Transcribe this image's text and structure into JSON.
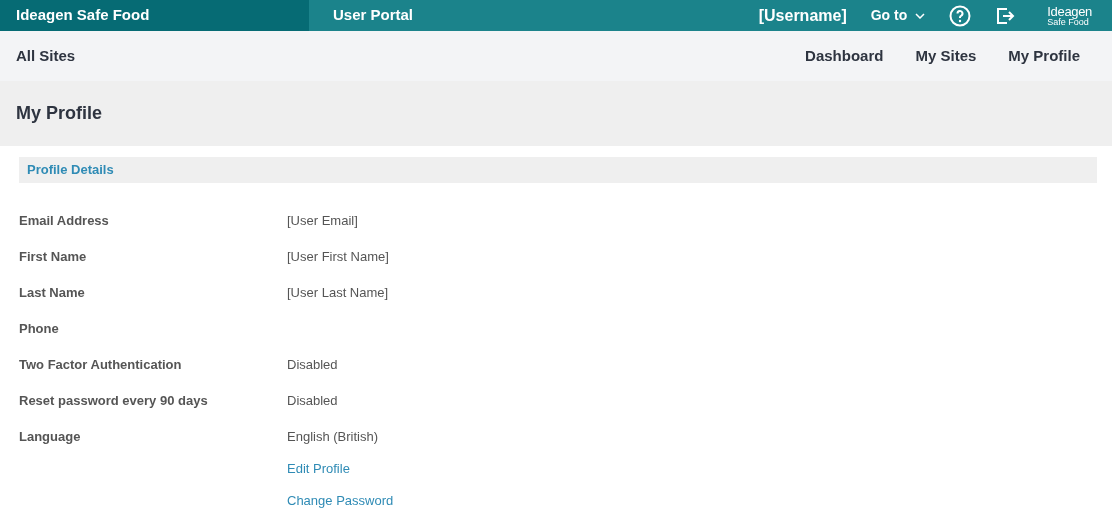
{
  "top_bar": {
    "brand": "Ideagen Safe Food",
    "portal": "User Portal",
    "username": "[Username]",
    "goto": "Go to",
    "logo": {
      "name": "Ideagen",
      "sub": "Safe Food"
    }
  },
  "nav": {
    "title": "All Sites",
    "links": [
      "Dashboard",
      "My Sites",
      "My Profile"
    ]
  },
  "page_title": "My Profile",
  "section": {
    "title": "Profile Details",
    "fields": [
      {
        "label": "Email Address",
        "value": "[User Email]"
      },
      {
        "label": "First Name",
        "value": "[User First Name]"
      },
      {
        "label": "Last Name",
        "value": "[User Last Name]"
      },
      {
        "label": "Phone"
      },
      {
        "label": "Two Factor Authentication",
        "value": "Disabled"
      },
      {
        "label": "Reset password every 90 days",
        "value": "Disabled"
      },
      {
        "label": "Language",
        "value": "English (British)"
      }
    ],
    "links": [
      "Edit Profile",
      "Change Password"
    ]
  }
}
